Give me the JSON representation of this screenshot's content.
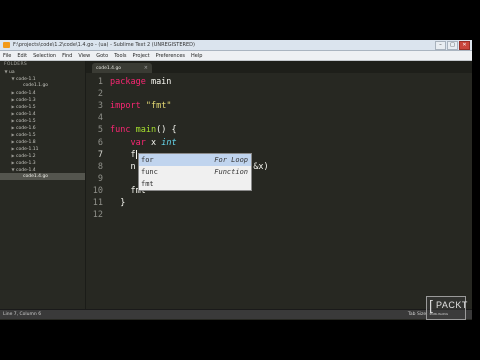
{
  "window": {
    "title": "F:\\projects\\code\\1.2\\code\\1.4.go - (ua) - Sublime Text 2 (UNREGISTERED)",
    "controls": {
      "minimize": "–",
      "maximize": "□",
      "close": "✕"
    }
  },
  "menu": [
    "File",
    "Edit",
    "Selection",
    "Find",
    "View",
    "Goto",
    "Tools",
    "Project",
    "Preferences",
    "Help"
  ],
  "sidebar": {
    "header": "FOLDERS",
    "items": [
      {
        "label": "ua",
        "indent": 1,
        "arrow": "▼",
        "selected": false
      },
      {
        "label": "code-1.1",
        "indent": 2,
        "arrow": "▼",
        "selected": false
      },
      {
        "label": "code1.1.go",
        "indent": 3,
        "arrow": "",
        "selected": false
      },
      {
        "label": "code-1.4",
        "indent": 2,
        "arrow": "▶",
        "selected": false
      },
      {
        "label": "code-1.3",
        "indent": 2,
        "arrow": "▶",
        "selected": false
      },
      {
        "label": "code-1.5",
        "indent": 2,
        "arrow": "▶",
        "selected": false
      },
      {
        "label": "code-1.4",
        "indent": 2,
        "arrow": "▶",
        "selected": false
      },
      {
        "label": "code-1.5",
        "indent": 2,
        "arrow": "▶",
        "selected": false
      },
      {
        "label": "code-1.6",
        "indent": 2,
        "arrow": "▶",
        "selected": false
      },
      {
        "label": "code-1.5",
        "indent": 2,
        "arrow": "▶",
        "selected": false
      },
      {
        "label": "code-1.8",
        "indent": 2,
        "arrow": "▶",
        "selected": false
      },
      {
        "label": "code-1.11",
        "indent": 2,
        "arrow": "▶",
        "selected": false
      },
      {
        "label": "code-1.2",
        "indent": 2,
        "arrow": "▶",
        "selected": false
      },
      {
        "label": "code-1.3",
        "indent": 2,
        "arrow": "▶",
        "selected": false
      },
      {
        "label": "code-1.4",
        "indent": 2,
        "arrow": "▼",
        "selected": false
      },
      {
        "label": "code1.4.go",
        "indent": 3,
        "arrow": "",
        "selected": true
      }
    ]
  },
  "tab": {
    "label": "code1.4.go",
    "close": "×"
  },
  "editor": {
    "lines": [
      {
        "n": "1",
        "tokens": [
          {
            "t": "package",
            "c": "kw"
          },
          {
            "t": " main",
            "c": ""
          }
        ]
      },
      {
        "n": "2",
        "tokens": []
      },
      {
        "n": "3",
        "tokens": [
          {
            "t": "import",
            "c": "kw"
          },
          {
            "t": " ",
            "c": ""
          },
          {
            "t": "\"fmt\"",
            "c": "str"
          }
        ]
      },
      {
        "n": "4",
        "tokens": []
      },
      {
        "n": "5",
        "tokens": [
          {
            "t": "func",
            "c": "kw"
          },
          {
            "t": " ",
            "c": ""
          },
          {
            "t": "main",
            "c": "fn"
          },
          {
            "t": "() {",
            "c": ""
          }
        ]
      },
      {
        "n": "6",
        "tokens": [
          {
            "t": "    ",
            "c": ""
          },
          {
            "t": "var",
            "c": "kw"
          },
          {
            "t": " x ",
            "c": ""
          },
          {
            "t": "int",
            "c": "typ"
          }
        ]
      },
      {
        "n": "7",
        "tokens": [
          {
            "t": "    f",
            "c": ""
          }
        ],
        "cursor": true,
        "active": true
      },
      {
        "n": "8",
        "tokens": [
          {
            "t": "    n",
            "c": ""
          },
          {
            "t": "                  ",
            "c": ""
          },
          {
            "t": "%d\"",
            "c": "str"
          },
          {
            "t": ", &x)",
            "c": ""
          }
        ]
      },
      {
        "n": "9",
        "tokens": []
      },
      {
        "n": "10",
        "tokens": [
          {
            "t": "    f",
            "c": ""
          },
          {
            "t": "mt",
            "c": ""
          }
        ]
      },
      {
        "n": "11",
        "tokens": [
          {
            "t": "  }",
            "c": ""
          }
        ]
      },
      {
        "n": "12",
        "tokens": []
      }
    ]
  },
  "autocomplete": {
    "items": [
      {
        "trigger": "for",
        "hint": "For Loop",
        "selected": true
      },
      {
        "trigger": "func",
        "hint": "Function",
        "selected": false
      },
      {
        "trigger": "fmt",
        "hint": "",
        "selected": false
      }
    ]
  },
  "status": {
    "left": "Line 7, Column 6",
    "right": "Tab Size: 4"
  },
  "watermark": {
    "text": "PACKT",
    "sub": "PUBLISHING",
    "bracket": "["
  },
  "colors": {
    "editor_bg": "#272822",
    "keyword": "#f92672",
    "string": "#e6db74",
    "function": "#a6e22e",
    "type": "#66d9ef"
  }
}
